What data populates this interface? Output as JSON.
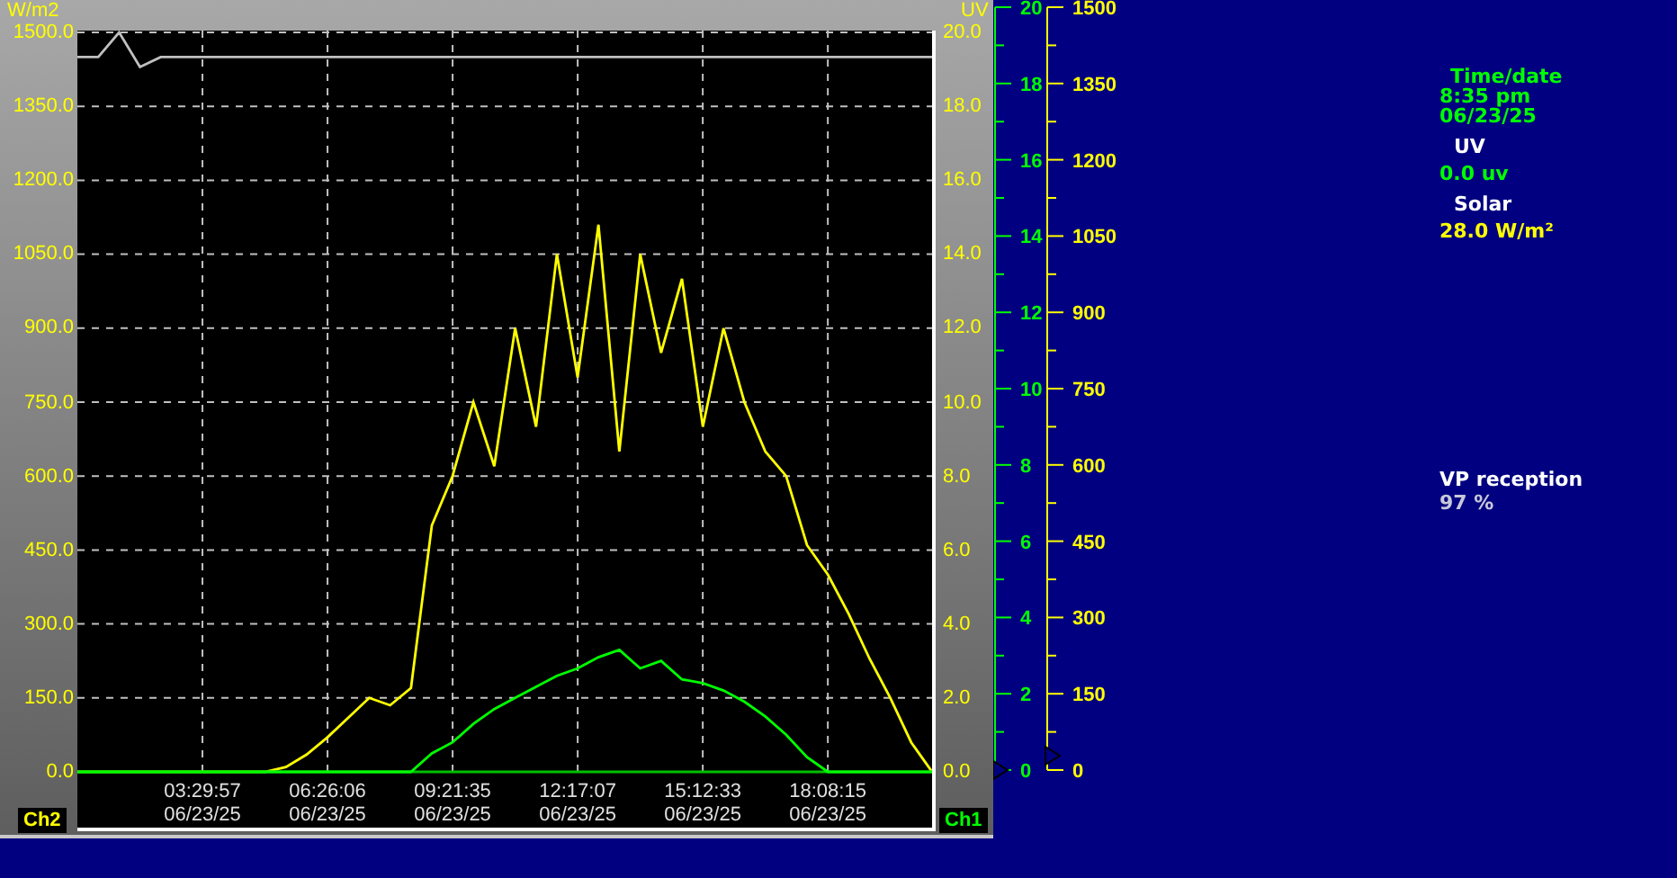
{
  "chart": {
    "charts": [
      {
        "chart_data": {
          "type": "line",
          "grid": true,
          "ylabel": "W/m2",
          "ylim": [
            0,
            1500
          ],
          "yticks": [
            {
              "value": 0,
              "label": "0.0"
            },
            {
              "value": 150,
              "label": "150.0"
            },
            {
              "value": 300,
              "label": "300.0"
            },
            {
              "value": 450,
              "label": "450.0"
            },
            {
              "value": 600,
              "label": "600.0"
            },
            {
              "value": 750,
              "label": "750.0"
            },
            {
              "value": 900,
              "label": "900.0"
            },
            {
              "value": 1050,
              "label": "1050.0"
            },
            {
              "value": 1200,
              "label": "1200.0"
            },
            {
              "value": 1350,
              "label": "1350.0"
            },
            {
              "value": 1500,
              "label": "1500.0"
            }
          ],
          "categories": [
            null,
            null,
            null,
            null,
            null,
            null,
            "03:29:57 06/23/25",
            null,
            null,
            null,
            null,
            null,
            "06:26:06 06/23/25",
            null,
            null,
            null,
            null,
            null,
            "09:21:35 06/23/25",
            null,
            null,
            null,
            null,
            null,
            "12:17:07 06/23/25",
            null,
            null,
            null,
            null,
            null,
            "15:12:33 06/23/25",
            null,
            null,
            null,
            null,
            null,
            "18:08:15 06/23/25",
            null,
            null,
            null,
            null,
            null
          ],
          "series": [
            {
              "color": "#ffff00",
              "values": [
                0,
                0,
                0,
                0,
                0,
                0,
                0,
                0,
                0,
                0,
                10,
                35,
                70,
                110,
                150,
                135,
                170,
                500,
                600,
                750,
                620,
                900,
                700,
                1050,
                800,
                1110,
                650,
                1050,
                850,
                1000,
                700,
                900,
                750,
                650,
                600,
                460,
                400,
                320,
                230,
                150,
                60,
                0
              ]
            },
            {
              "color": "#c0c0c0",
              "values": [
                1450,
                1450,
                1500,
                1430,
                1450,
                1450,
                1450,
                1450,
                1450,
                1450,
                1450,
                1450,
                1450,
                1450,
                1450,
                1450,
                1450,
                1450,
                1450,
                1450,
                1450,
                1450,
                1450,
                1450,
                1450,
                1450,
                1450,
                1450,
                1450,
                1450,
                1450,
                1450,
                1450,
                1450,
                1450,
                1450,
                1450,
                1450,
                1450,
                1450,
                1450,
                1450
              ]
            }
          ]
        }
      },
      {
        "chart_data": {
          "type": "line",
          "ylabel": "UV",
          "ylim": [
            0,
            20
          ],
          "yticks": [
            {
              "value": 0,
              "label": "0.0"
            },
            {
              "value": 2,
              "label": "2.0"
            },
            {
              "value": 4,
              "label": "4.0"
            },
            {
              "value": 6,
              "label": "6.0"
            },
            {
              "value": 8,
              "label": "8.0"
            },
            {
              "value": 10,
              "label": "10.0"
            },
            {
              "value": 12,
              "label": "12.0"
            },
            {
              "value": 14,
              "label": "14.0"
            },
            {
              "value": 16,
              "label": "16.0"
            },
            {
              "value": 18,
              "label": "18.0"
            },
            {
              "value": 20,
              "label": "20.0"
            }
          ],
          "categories": [
            null,
            null,
            null,
            null,
            null,
            null,
            null,
            null,
            null,
            null,
            null,
            null,
            null,
            null,
            null,
            null,
            null,
            null,
            null,
            null,
            null,
            null,
            null,
            null,
            null,
            null,
            null,
            null,
            null,
            null,
            null,
            null,
            null,
            null,
            null,
            null,
            null,
            null,
            null,
            null,
            null,
            null
          ],
          "series": [
            {
              "color": "#00ff00",
              "values": [
                0,
                0,
                0,
                0,
                0,
                0,
                0,
                0,
                0,
                0,
                0,
                0,
                0,
                0,
                0,
                0,
                0,
                0.5,
                0.8,
                1.3,
                1.7,
                2.0,
                2.3,
                2.6,
                2.8,
                3.1,
                3.3,
                2.8,
                3.0,
                2.5,
                2.4,
                2.2,
                1.9,
                1.5,
                1.0,
                0.4,
                0,
                0,
                0,
                0,
                0,
                0
              ]
            }
          ]
        }
      }
    ],
    "badges": [
      {
        "label": "Ch2"
      },
      {
        "label": "Ch1"
      }
    ]
  },
  "scales": [
    {
      "color": "#00ff00",
      "labels": [
        "20",
        "18",
        "16",
        "14",
        "12",
        "10",
        "8",
        "6",
        "4",
        "2",
        "0"
      ]
    },
    {
      "color": "#ffff00",
      "labels": [
        "1500",
        "1350",
        "1200",
        "1050",
        "900",
        "750",
        "600",
        "450",
        "300",
        "150",
        "0"
      ]
    }
  ],
  "readings": [
    {
      "kind": "heading",
      "text": "Time/date",
      "color": "#00ff00"
    },
    {
      "kind": "value",
      "text": "8:35 pm",
      "color": "#00ff00"
    },
    {
      "kind": "value",
      "text": "06/23/25",
      "color": "#00ff00"
    },
    {
      "kind": "label",
      "text": "UV",
      "color": "#ffffff"
    },
    {
      "kind": "value",
      "text": "0.0 uv",
      "color": "#00ff00"
    },
    {
      "kind": "label",
      "text": "Solar",
      "color": "#ffffff"
    },
    {
      "kind": "value",
      "text": "28.0 W/m²",
      "color": "#ffff00"
    }
  ],
  "reception": {
    "label": "VP reception",
    "value": "97 %"
  }
}
